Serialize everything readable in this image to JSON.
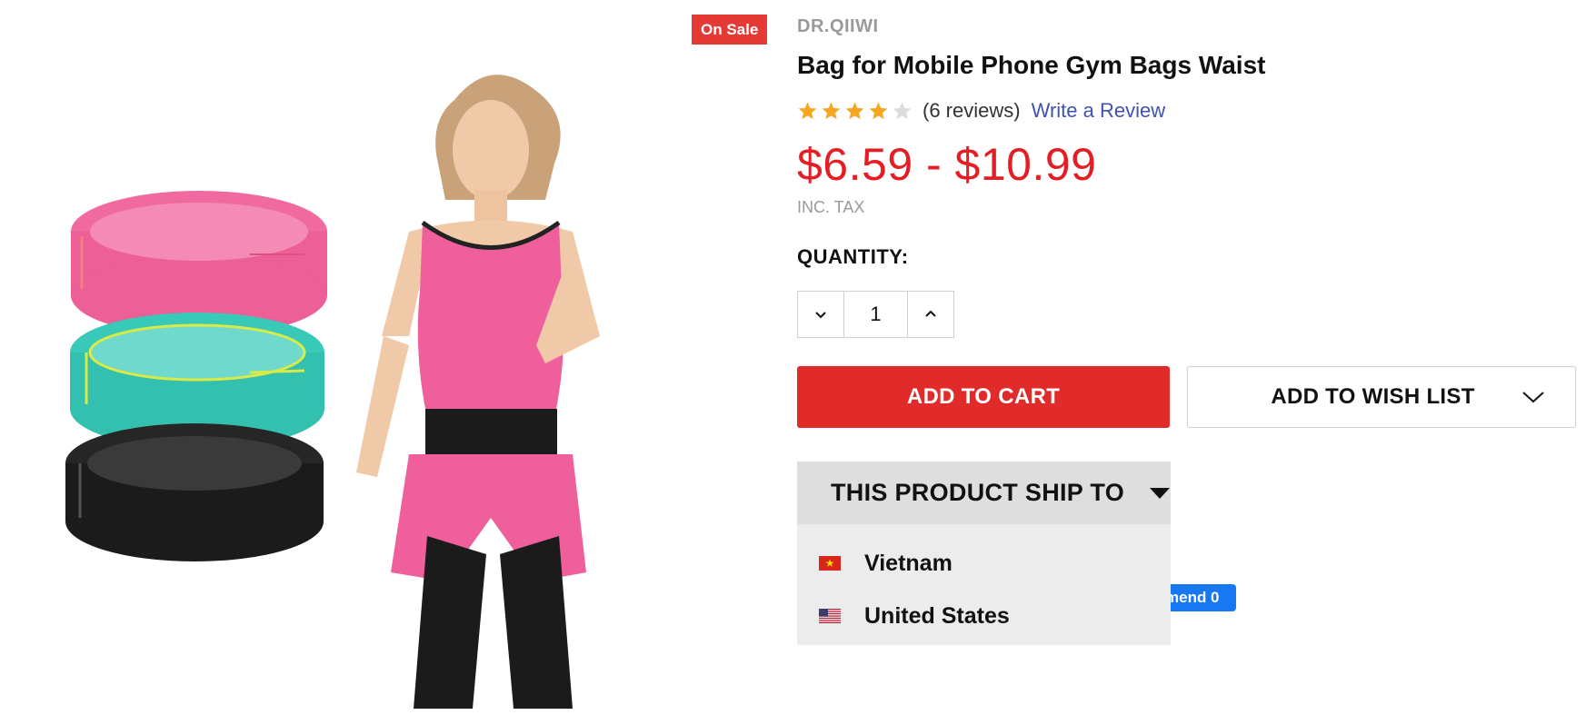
{
  "badge": {
    "sale_label": "On Sale"
  },
  "product": {
    "brand": "DR.QIIWI",
    "title": "Bag for Mobile Phone Gym Bags Waist",
    "rating": {
      "value": 4,
      "max": 5,
      "review_count_label": "(6 reviews)",
      "write_review_label": "Write a Review"
    },
    "price": "$6.59 - $10.99",
    "tax_note": "INC. TAX"
  },
  "quantity": {
    "label": "QUANTITY:",
    "value": "1"
  },
  "actions": {
    "add_to_cart": "ADD TO CART",
    "add_to_wishlist": "ADD TO WISH LIST"
  },
  "shipping": {
    "header": "THIS PRODUCT SHIP TO",
    "countries": [
      {
        "name": "Vietnam",
        "flag": "vietnam-flag"
      },
      {
        "name": "United States",
        "flag": "us-flag"
      }
    ]
  },
  "social": {
    "recommend_label": "mend 0"
  },
  "colors": {
    "price": "#e31e24",
    "cart_button": "#e12b2b",
    "sale_badge": "#e53935",
    "star_filled": "#f5a623",
    "star_empty": "#dcdcdc",
    "link": "#3f51b5",
    "facebook": "#1877f2"
  }
}
